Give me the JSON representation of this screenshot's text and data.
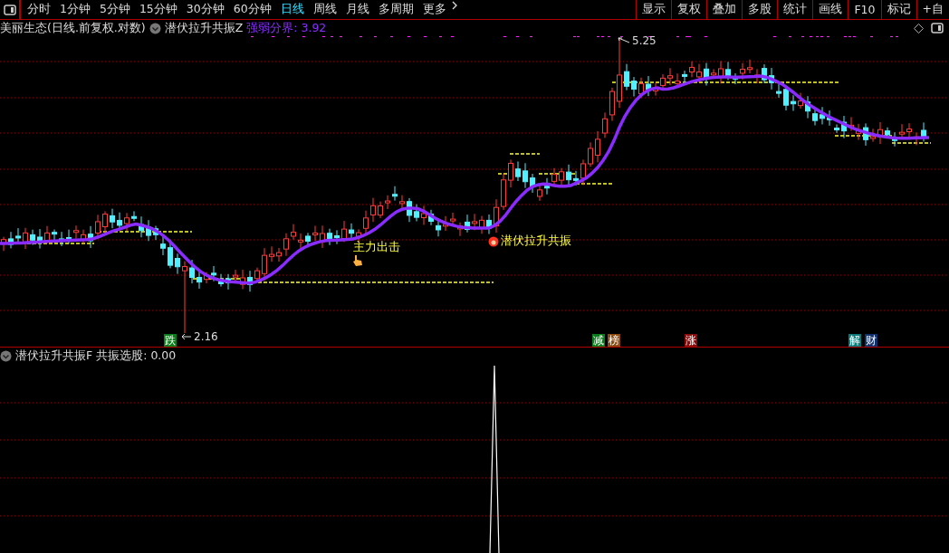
{
  "toolbar": {
    "periods": [
      {
        "label": "分时",
        "selected": false
      },
      {
        "label": "1分钟",
        "selected": false
      },
      {
        "label": "5分钟",
        "selected": false
      },
      {
        "label": "15分钟",
        "selected": false
      },
      {
        "label": "30分钟",
        "selected": false
      },
      {
        "label": "60分钟",
        "selected": false
      },
      {
        "label": "日线",
        "selected": true
      },
      {
        "label": "周线",
        "selected": false
      },
      {
        "label": "月线",
        "selected": false
      },
      {
        "label": "多周期",
        "selected": false
      },
      {
        "label": "更多",
        "selected": false
      }
    ],
    "actions": [
      "显示",
      "复权",
      "叠加",
      "多股",
      "统计",
      "画线",
      "F10",
      "标记",
      "+自"
    ]
  },
  "main_panel": {
    "stock_title": "美丽生态(日线.前复权.对数)",
    "indicator_name": "潜伏拉升共振Z",
    "indicator_value": "强弱分界: 3.92",
    "high_label": "5.25",
    "low_label": "2.16",
    "signals": [
      {
        "kind": "hand",
        "label": "主力出击"
      },
      {
        "kind": "dot",
        "label": "潜伏拉升共振"
      }
    ],
    "events": [
      {
        "label": "跌",
        "color": "#0a7d1a"
      },
      {
        "label": "减",
        "color": "#0a7d1a"
      },
      {
        "label": "榜",
        "color": "#8a4a10"
      },
      {
        "label": "涨",
        "color": "#8a0a0a"
      },
      {
        "label": "解",
        "color": "#0a7a7a"
      },
      {
        "label": "财",
        "color": "#10306a"
      }
    ]
  },
  "sub_panel": {
    "indicator_name": "潜伏拉升共振F",
    "indicator_value": "共振选股: 0.00"
  }
}
